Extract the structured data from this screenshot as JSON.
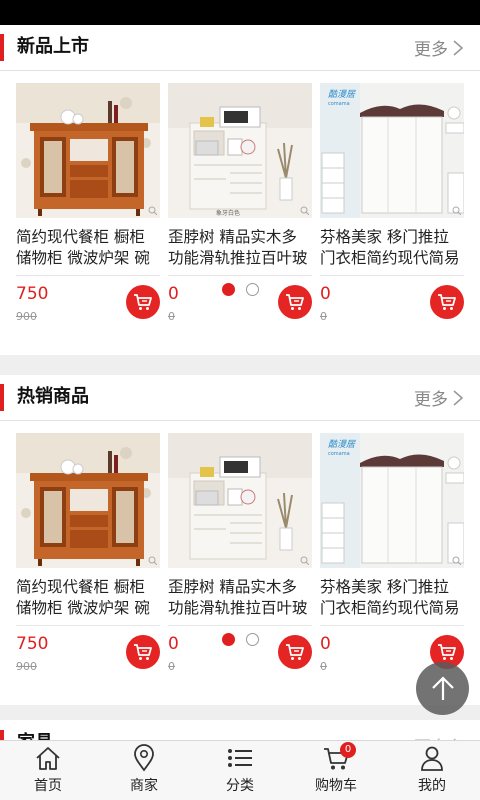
{
  "sections": [
    {
      "title": "新品上市",
      "more": "更多",
      "products": [
        {
          "name": "简约现代餐柜 橱柜储物柜 微波炉架 碗柜",
          "price": "750",
          "old_price": "900"
        },
        {
          "name": "歪脖树 精品实木多功能滑轨推拉百叶玻璃门",
          "price": "0",
          "old_price": "0",
          "img_caption": "象牙白色"
        },
        {
          "name": "芬格美家 移门推拉门衣柜简约现代简易组装",
          "price": "0",
          "old_price": "0",
          "img_brand": "酷漫居",
          "img_brand_sub": "comama"
        }
      ]
    },
    {
      "title": "热销商品",
      "more": "更多",
      "products": [
        {
          "name": "简约现代餐柜 橱柜储物柜 微波炉架 碗柜",
          "price": "750",
          "old_price": "900"
        },
        {
          "name": "歪脖树 精品实木多功能滑轨推拉百叶玻璃门",
          "price": "0",
          "old_price": "0",
          "img_caption": "象牙白色"
        },
        {
          "name": "芬格美家 移门推拉门衣柜简约现代简易组装",
          "price": "0",
          "old_price": "0",
          "img_brand": "酷漫居",
          "img_brand_sub": "comama"
        }
      ]
    },
    {
      "title": "家具",
      "more": "更多"
    }
  ],
  "tabbar": {
    "items": [
      {
        "label": "首页",
        "icon": "home-icon"
      },
      {
        "label": "商家",
        "icon": "location-pin-icon"
      },
      {
        "label": "分类",
        "icon": "list-icon"
      },
      {
        "label": "购物车",
        "icon": "cart-icon",
        "badge": "0"
      },
      {
        "label": "我的",
        "icon": "person-icon"
      }
    ]
  },
  "colors": {
    "accent": "#e02020",
    "cart_button": "#e52424",
    "fab": "#5a5a5a"
  }
}
